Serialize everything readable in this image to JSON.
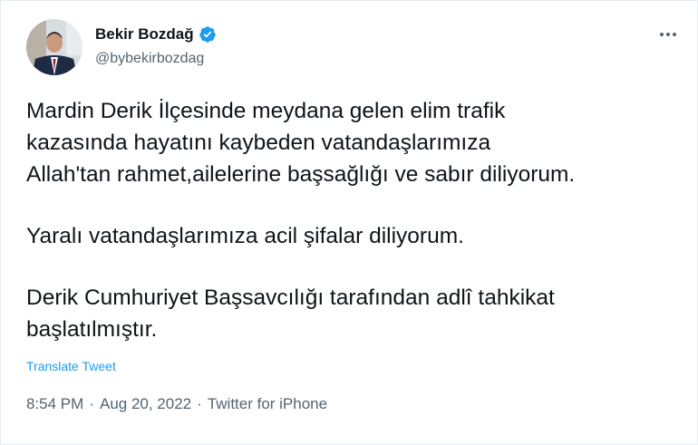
{
  "author": {
    "name": "Bekir Bozdağ",
    "handle": "@bybekirbozdag"
  },
  "tweet": {
    "lines": [
      "Mardin Derik İlçesinde meydana gelen elim trafik",
      "kazasında hayatını kaybeden vatandaşlarımıza",
      "Allah'tan rahmet,ailelerine başsağlığı ve sabır diliyorum.",
      "Yaralı vatandaşlarımıza acil şifalar diliyorum.",
      "Derik Cumhuriyet Başsavcılığı tarafından adlî tahkikat",
      "başlatılmıştır."
    ],
    "translate_label": "Translate Tweet",
    "time": "8:54 PM",
    "date": "Aug 20, 2022",
    "source": "Twitter for iPhone",
    "separator": "·"
  },
  "colors": {
    "accent": "#1d9bf0",
    "text": "#0f1419",
    "secondary": "#536471"
  },
  "icons": {
    "verified": "verified-badge-icon",
    "more": "more-horizontal-icon"
  }
}
